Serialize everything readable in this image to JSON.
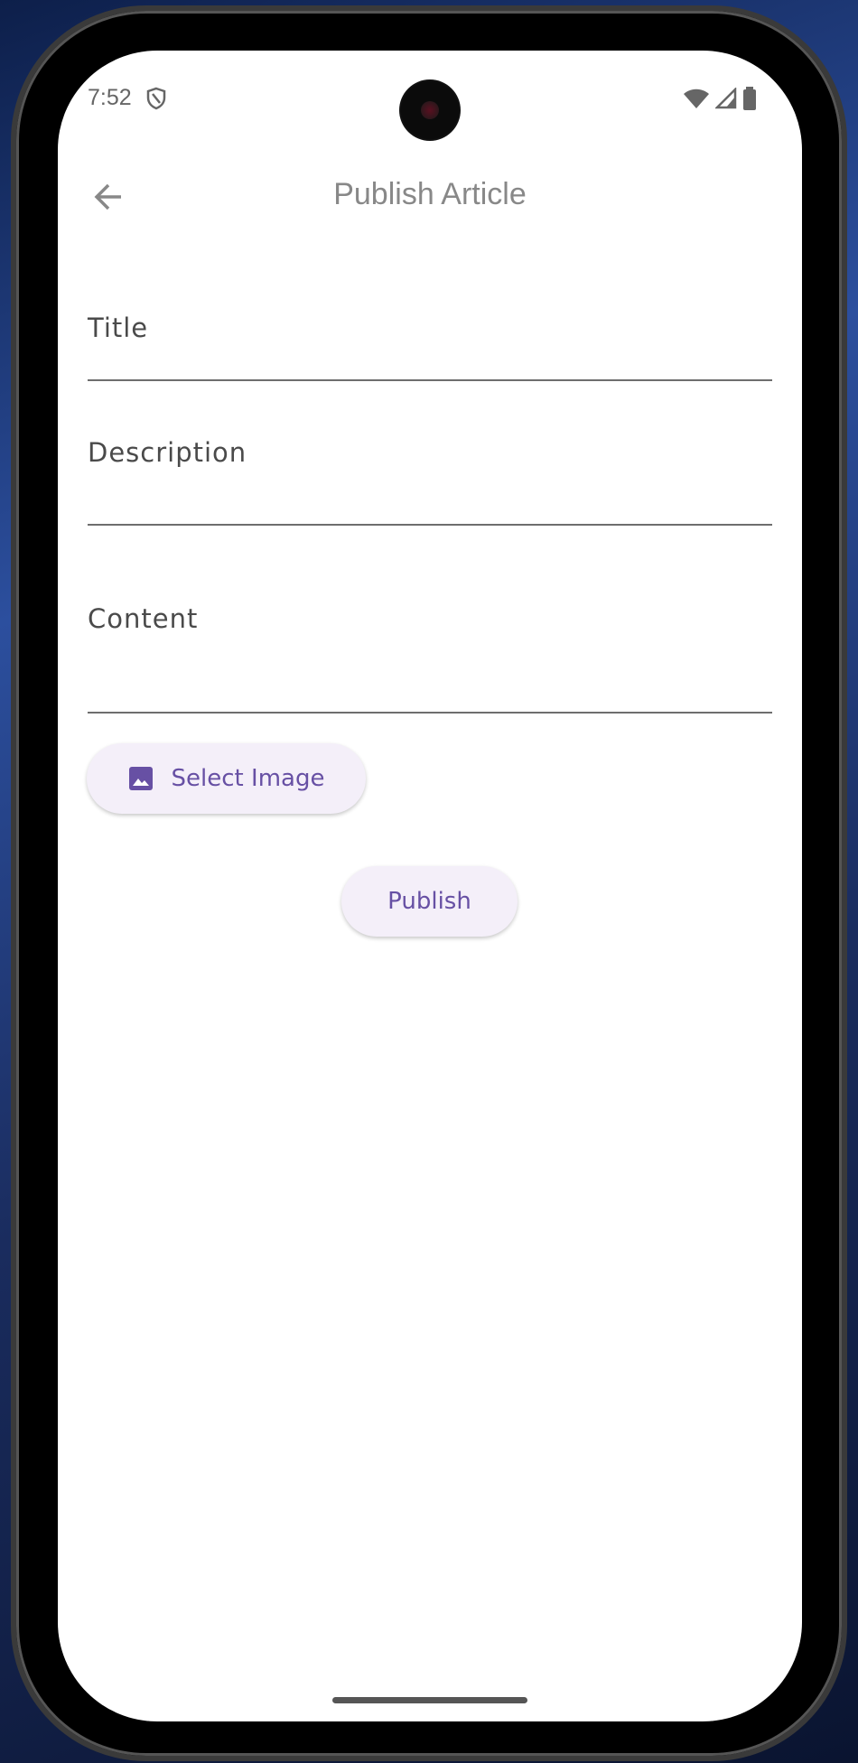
{
  "status_bar": {
    "time": "7:52"
  },
  "app_bar": {
    "title": "Publish Article"
  },
  "form": {
    "fields": [
      {
        "label": "Title",
        "value": ""
      },
      {
        "label": "Description",
        "value": ""
      },
      {
        "label": "Content",
        "value": ""
      }
    ],
    "select_image_label": "Select Image",
    "publish_label": "Publish"
  },
  "colors": {
    "accent": "#6750a4",
    "button_bg": "#f4eff9"
  }
}
